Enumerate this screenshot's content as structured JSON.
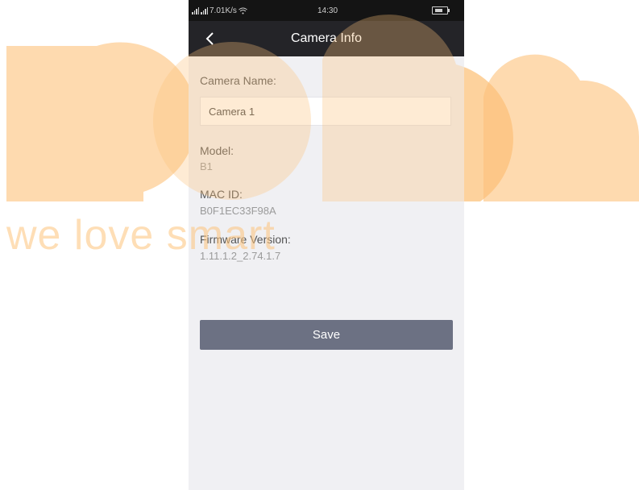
{
  "status_bar": {
    "network_speed": "7.01K/s",
    "time": "14:30"
  },
  "header": {
    "title": "Camera Info",
    "back_icon": "chevron-left-icon"
  },
  "form": {
    "camera_name_label": "Camera Name:",
    "camera_name_value": "Camera 1",
    "model_label": "Model:",
    "model_value": "B1",
    "mac_label": "MAC ID:",
    "mac_value": "B0F1EC33F98A",
    "firmware_label": "Firmware Version:",
    "firmware_value": "1.11.1.2_2.74.1.7",
    "save_label": "Save"
  },
  "watermark": {
    "tagline": "we love smart",
    "color": "#fdc27a"
  },
  "colors": {
    "navbar": "#242428",
    "statusbar": "#141414",
    "background": "#f0f0f3",
    "button": "#6c7183"
  }
}
